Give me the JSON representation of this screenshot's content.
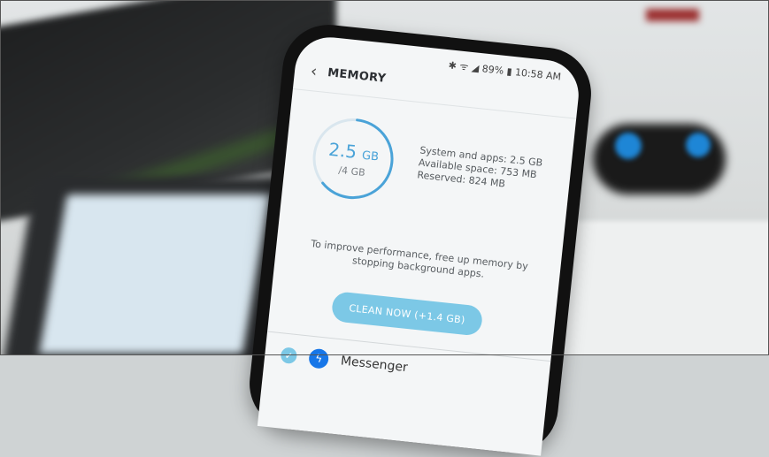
{
  "status_bar": {
    "text": "✱ ᯤ ◢ 89% ▮ 10:58 AM"
  },
  "header": {
    "back_icon": "chevron-left-icon",
    "title": "MEMORY"
  },
  "memory": {
    "used_value": "2.5",
    "used_unit": "GB",
    "total": "/4 GB",
    "used_fraction": 0.625,
    "ring_color": "#4aa3d8"
  },
  "stats": {
    "system_apps": "System and apps: 2.5 GB",
    "available": "Available space: 753 MB",
    "reserved": "Reserved: 824 MB"
  },
  "hint": "To improve performance, free up memory by stopping background apps.",
  "clean_button": {
    "label": "CLEAN NOW (+1.4 GB)",
    "color": "#7cc8e6"
  },
  "apps": [
    {
      "name": "Messenger",
      "checked": true,
      "icon": "messenger-icon"
    }
  ]
}
